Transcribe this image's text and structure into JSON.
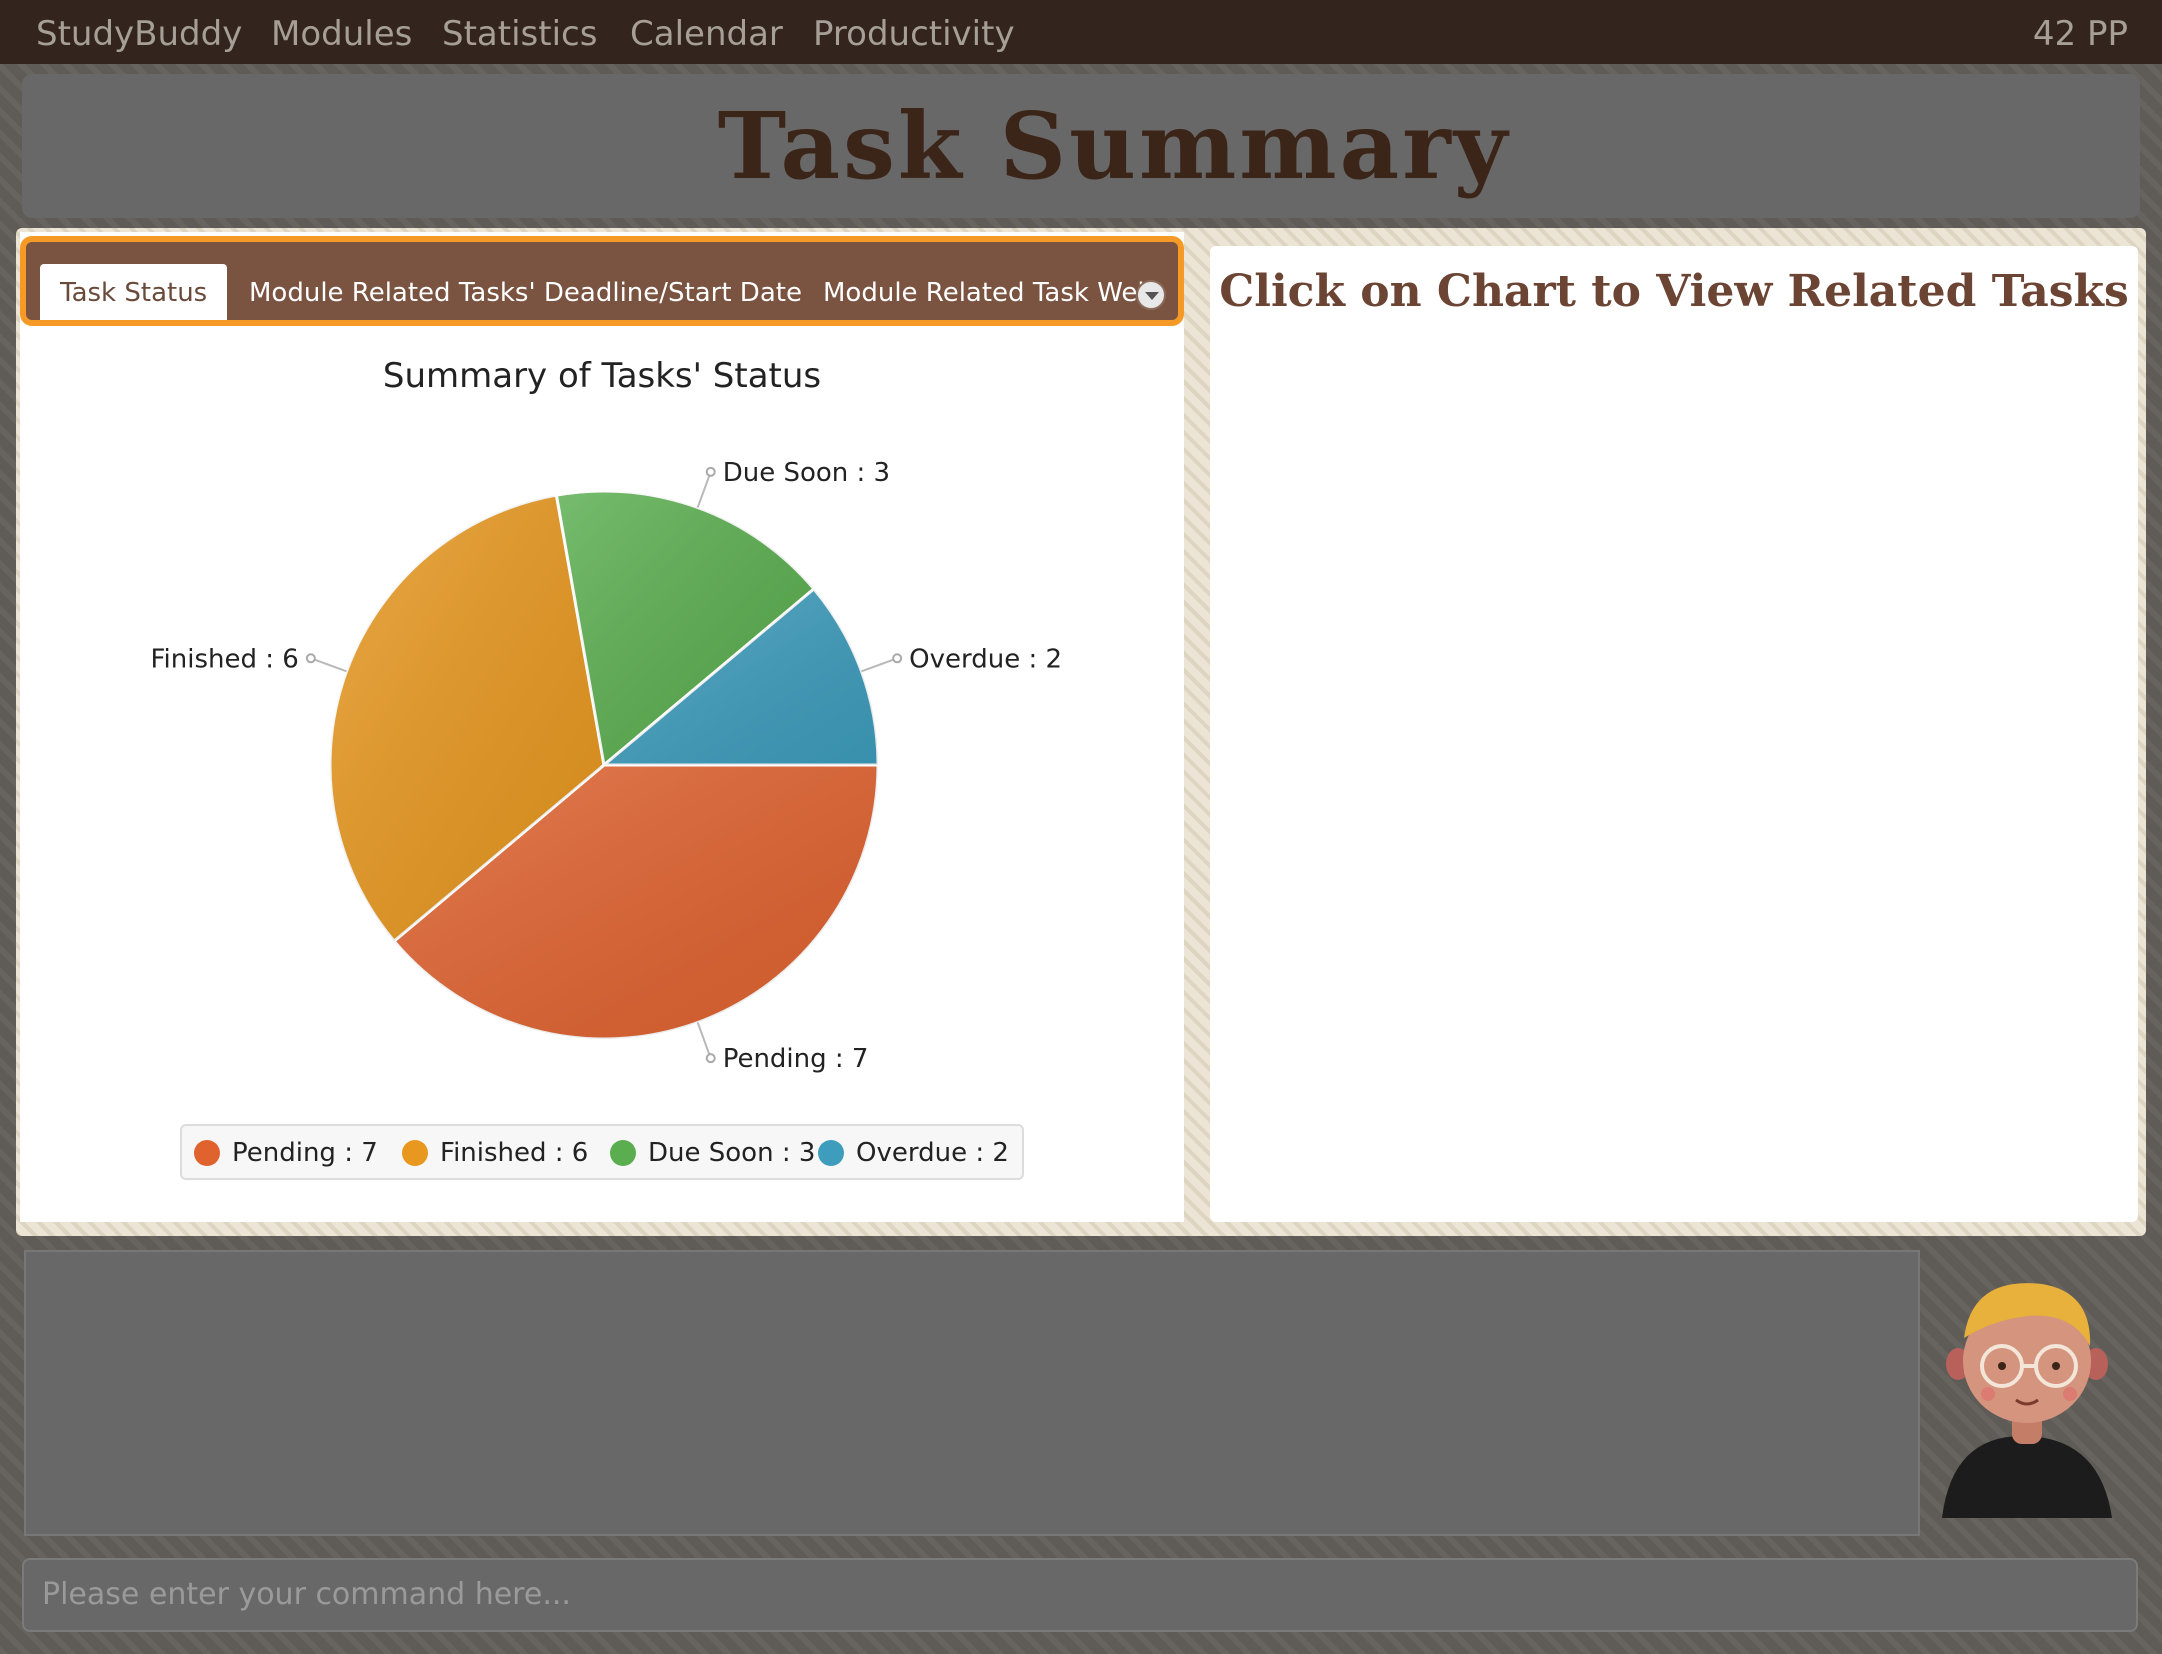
{
  "menubar": {
    "items": [
      "StudyBuddy",
      "Modules",
      "Statistics",
      "Calendar",
      "Productivity"
    ],
    "points": "42 PP"
  },
  "header": {
    "title": "Task Summary"
  },
  "tabs": [
    {
      "label": "Task Status",
      "active": true
    },
    {
      "label": "Module Related Tasks' Deadline/Start Date",
      "active": false
    },
    {
      "label": "Module Related Task Wei",
      "active": false
    }
  ],
  "right_panel": {
    "heading": "Click on Chart to View Related Tasks"
  },
  "command": {
    "placeholder": "Please enter your command here..."
  },
  "chart_data": {
    "type": "pie",
    "title": "Summary of Tasks' Status",
    "slices": [
      {
        "name": "Pending",
        "value": 7,
        "color": "#e0622f",
        "label": "Pending : 7"
      },
      {
        "name": "Finished",
        "value": 6,
        "color": "#e8981f",
        "label": "Finished : 6"
      },
      {
        "name": "Due Soon",
        "value": 3,
        "color": "#5aae4f",
        "label": "Due Soon : 3"
      },
      {
        "name": "Overdue",
        "value": 2,
        "color": "#3e9dbd",
        "label": "Overdue : 2"
      }
    ],
    "legend": "bottom"
  },
  "colors": {
    "menubar": "#33241e",
    "tab_border": "#f59a26",
    "tab_header": "#7a5341",
    "title": "#3b2418"
  }
}
